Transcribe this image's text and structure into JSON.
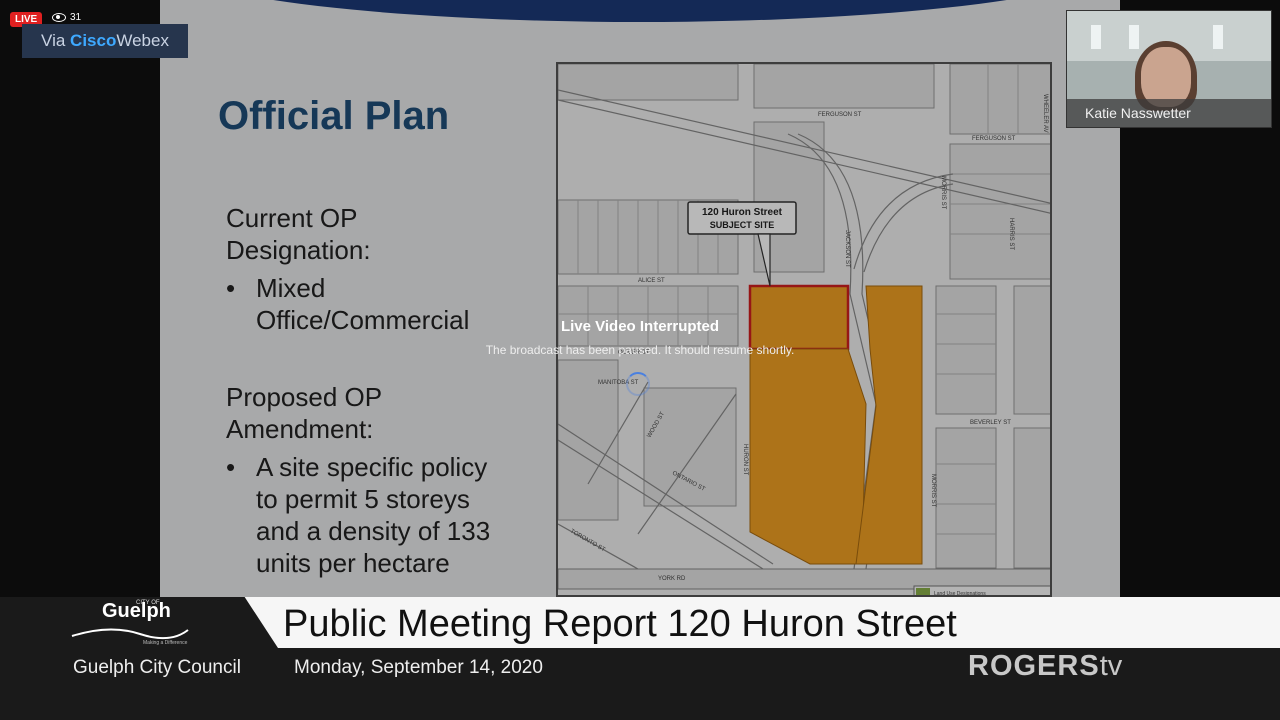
{
  "stream": {
    "live_label": "LIVE",
    "viewer_count": "31",
    "via_prefix": "Via ",
    "via_brand_a": "Cisco",
    "via_brand_b": "Webex"
  },
  "slide": {
    "title": "Official Plan",
    "current_heading": "Current OP Designation:",
    "current_item": "Mixed Office/Commercial",
    "proposed_heading": "Proposed OP Amendment:",
    "proposed_item": "A site specific policy to permit 5 storeys and a density of 133 units per hectare"
  },
  "map": {
    "callout": "120 Huron Street",
    "callout_sub": "SUBJECT SITE",
    "streets": {
      "ferguson1": "FERGUSON ST",
      "ferguson2": "FERGUSON ST",
      "wheeler": "WHEELER AV",
      "alice": "ALICE ST",
      "oliver": "OLIVER ST",
      "manitoba": "MANITOBA ST",
      "wood": "WOOD ST",
      "huron": "HURON ST",
      "ontario": "ONTARIO ST",
      "toronto": "TORONTO ST",
      "york": "YORK RD",
      "beverley": "BEVERLEY ST",
      "morris": "MORRIS ST",
      "harris": "HARRIS ST",
      "jackson": "JACKSON ST"
    },
    "legend": "Land Use Designations",
    "site_color": "#f0a023",
    "outline_color": "#d01f1f"
  },
  "presenter": {
    "name": "Katie Nasswetter"
  },
  "interruption": {
    "title": "Live Video Interrupted",
    "message": "The broadcast has been paused. It should resume shortly."
  },
  "lower_third": {
    "logo_city": "CITY OF",
    "logo_name": "Guelph",
    "logo_tagline": "Making a Difference",
    "title": "Public Meeting Report 120 Huron Street",
    "council": "Guelph City Council",
    "date": "Monday, September 14, 2020",
    "network_a": "ROGERS",
    "network_b": "tv"
  }
}
